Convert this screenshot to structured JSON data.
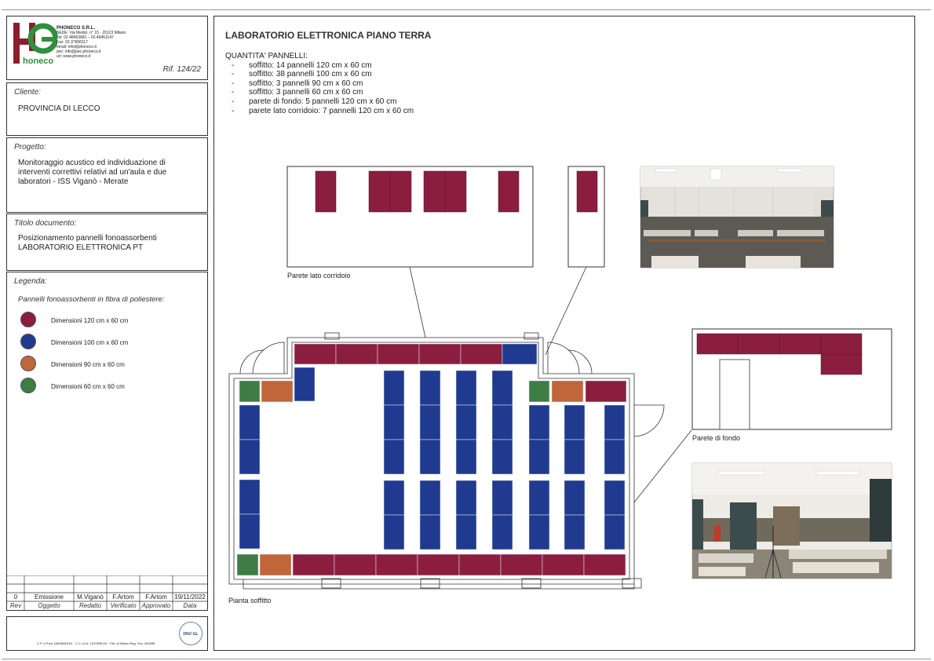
{
  "colors": {
    "panel_120x60": "#8B1E3F",
    "panel_100x60": "#1F3A8F",
    "panel_90x60": "#C0663A",
    "panel_60x60": "#3E7D44",
    "border": "#333333"
  },
  "company": {
    "logo_letters": "hp",
    "logo_text": "honeco",
    "name": "PHONECO S.R.L.",
    "address": "SEDE: Via Medici, n° 15 - 20123 Milano",
    "tel": "Tel: 02.48463681 – 02.49451147",
    "fax": "Fax: 02.37908117",
    "email": "email: info@phoneco.it",
    "pec": "pec: info@pec.phoneco.it",
    "url": "url: www.phoneco.it",
    "ref": "Rif. 124/22"
  },
  "client": {
    "label": "Cliente:",
    "value": "PROVINCIA DI LECCO"
  },
  "project": {
    "label": "Progetto:",
    "lines": [
      "Monitoraggio acustico ed individuazione di",
      "interventi correttivi relativi ad un'aula e due",
      "laboratori - ISS Viganò - Merate"
    ]
  },
  "doc_title": {
    "label": "Titolo documento:",
    "lines": [
      "Posizionamento pannelli fonoassorbenti",
      "LABORATORIO ELETTRONICA PT"
    ]
  },
  "legend": {
    "label": "Legenda:",
    "subtitle": "Pannelli fonoassorbenti in fibra di poliestere:",
    "items": [
      {
        "text": "Dimensioni 120 cm x 60 cm",
        "color": "#8B1E3F"
      },
      {
        "text": "Dimensioni 100 cm x 60 cm",
        "color": "#1F3A8F"
      },
      {
        "text": "Dimensioni 90 cm x 60 cm",
        "color": "#C0663A"
      },
      {
        "text": "Dimensioni 60 cm x 60 cm",
        "color": "#3E7D44"
      }
    ]
  },
  "revision_table": {
    "row": [
      "0",
      "Emissione",
      "M.Viganò",
      "F.Artom",
      "F.Artom",
      "19/11/2022"
    ],
    "headers": [
      "Rev",
      "Oggetto",
      "Redatto",
      "Verificato",
      "Approvato",
      "Data"
    ]
  },
  "footer": {
    "legal": "C.F. e P.iva 11509830151 - C.C.I.A.A. 1470096 MI - Trib. di Milano Reg. Soc. 354098",
    "cert": "DNV·GL"
  },
  "main": {
    "title": "LABORATORIO ELETTRONICA PIANO TERRA",
    "quantity_label": "QUANTITA' PANNELLI:",
    "quantity_items": [
      "soffitto: 14 pannelli 120 cm x 60 cm",
      "soffitto: 38 pannelli 100 cm x 60 cm",
      "soffitto: 3 pannelli 90 cm x 60 cm",
      "soffitto: 3 pannelli 60 cm x 60 cm",
      "parete di fondo: 5 pannelli 120 cm x 60 cm",
      "parete lato corridoio: 7 pannelli 120 cm x 60 cm"
    ],
    "caption_corridor": "Parete lato corridoio",
    "caption_back": "Parete di fondo",
    "caption_plan": "Pianta soffitto"
  }
}
